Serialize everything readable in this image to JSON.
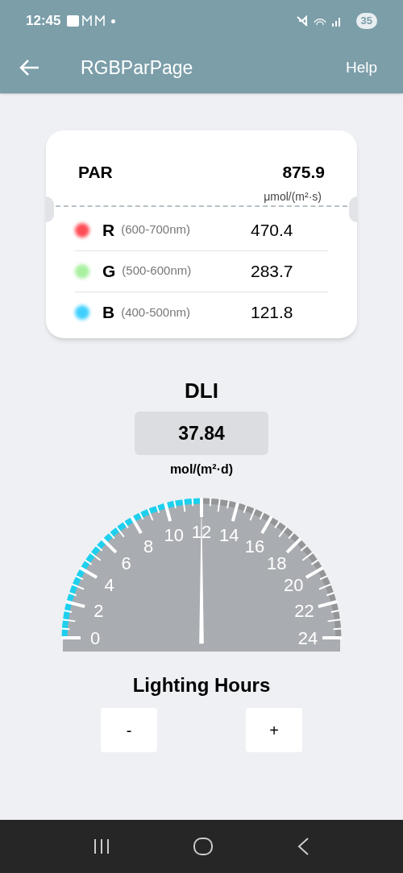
{
  "status_bar": {
    "time": "12:45",
    "battery": "35"
  },
  "app_bar": {
    "title": "RGBParPage",
    "action": "Help"
  },
  "par": {
    "label": "PAR",
    "value": "875.9",
    "unit": "μmol/(m²·s)",
    "channels": [
      {
        "letter": "R",
        "range": "(600-700nm)",
        "value": "470.4",
        "color": "#ff4d55"
      },
      {
        "letter": "G",
        "range": "(500-600nm)",
        "value": "283.7",
        "color": "#a8f0a0"
      },
      {
        "letter": "B",
        "range": "(400-500nm)",
        "value": "121.8",
        "color": "#3fd0ff"
      }
    ]
  },
  "dli": {
    "title": "DLI",
    "value": "37.84",
    "unit": "mol/(m²·d)"
  },
  "gauge": {
    "level": 0.5,
    "labels": [
      "0",
      "2",
      "4",
      "6",
      "8",
      "10",
      "12",
      "14",
      "16",
      "18",
      "20",
      "22",
      "24"
    ]
  },
  "lighting_hours": {
    "title": "Lighting Hours",
    "buttons": [
      "-",
      "+"
    ]
  }
}
